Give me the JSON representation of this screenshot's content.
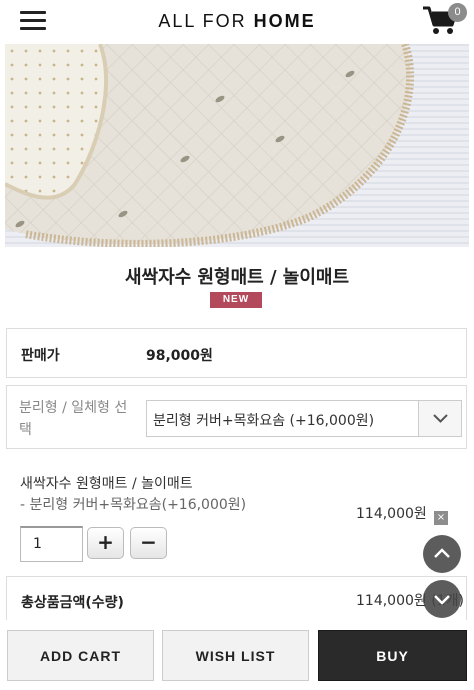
{
  "header": {
    "logo_light": "ALL FOR ",
    "logo_bold": "HOME",
    "cart_count": "0"
  },
  "product": {
    "title": "새싹자수 원형매트 / 놀이매트",
    "badge": "NEW"
  },
  "price": {
    "label": "판매가",
    "value": "98,000원"
  },
  "option": {
    "label": "분리형 / 일체형 선택",
    "selected": "분리형 커버+목화요솜 (+16,000원)"
  },
  "selected_item": {
    "name": "새싹자수 원형매트 / 놀이매트",
    "option": "- 분리형 커버+목화요솜(+16,000원)",
    "price": "114,000원",
    "quantity": "1",
    "remove_label": "×",
    "plus_label": "+",
    "minus_label": "−"
  },
  "total": {
    "label": "총상품금액(수량)",
    "value": "114,000원 (1개)"
  },
  "buttons": {
    "add_cart": "ADD CART",
    "wish_list": "WISH LIST",
    "buy": "BUY"
  },
  "icons": {
    "menu": "hamburger-menu-icon",
    "cart": "shopping-cart-icon",
    "select_arrow": "chevron-down-icon",
    "scroll_up": "chevron-up-icon",
    "scroll_down": "chevron-down-icon"
  },
  "colors": {
    "badge_new": "#b24a5b",
    "buy_button": "#2a2a2a",
    "cart_badge": "#8b8b8b"
  }
}
